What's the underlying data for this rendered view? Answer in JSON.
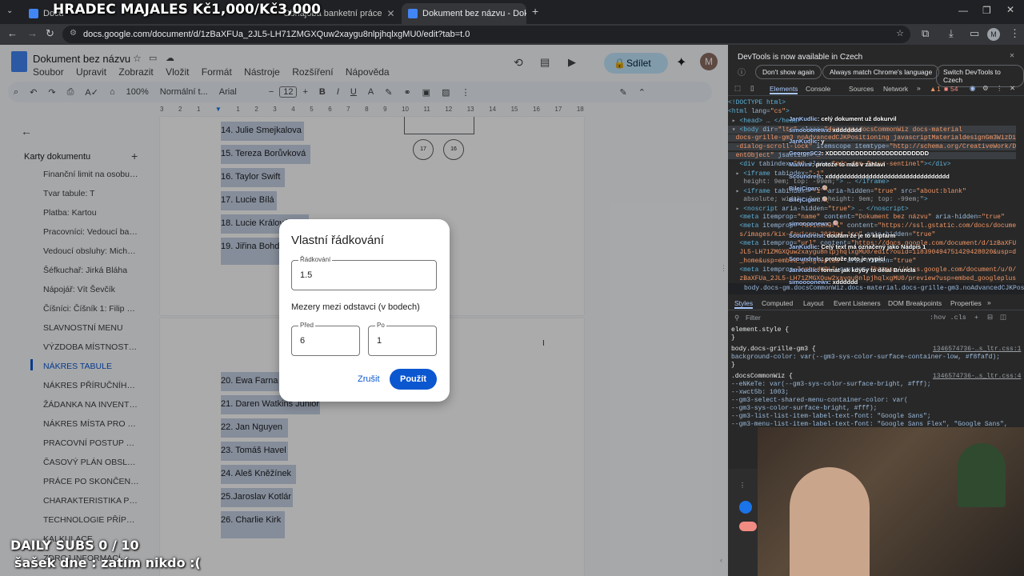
{
  "browser": {
    "tabs": [
      {
        "label": "Docu"
      },
      {
        "label": "Obhajoba banketní práce"
      },
      {
        "label": "Dokument bez názvu - Dokum"
      }
    ],
    "url": "docs.google.com/document/d/1zBaXFUa_2JL5-LH71ZMGXQuw2xaygu8nlpjhqlxgMU0/edit?tab=t.0"
  },
  "stream": {
    "banner": "HRADEC MAJALES Kč1,000/Kč3,000",
    "subs": "DAILY SUBS 0 / 10",
    "sasek": "šašek dne : zatím nikdo :("
  },
  "docs": {
    "title": "Dokument bez názvu",
    "menu": [
      "Soubor",
      "Upravit",
      "Zobrazit",
      "Vložit",
      "Formát",
      "Nástroje",
      "Rozšíření",
      "Nápověda"
    ],
    "share": "Sdílet",
    "avatar": "M",
    "toolbar": {
      "zoom": "100%",
      "style": "Normální t...",
      "font": "Arial",
      "size": "12"
    },
    "ruler": [
      "3",
      "2",
      "1",
      "1",
      "2",
      "3",
      "4",
      "5",
      "6",
      "7",
      "8",
      "9",
      "10",
      "11",
      "12",
      "13",
      "14",
      "15",
      "16",
      "17",
      "18"
    ],
    "sidebar": {
      "heading": "Karty dokumentu",
      "items": [
        "Finanční limit na osobu: 1...",
        "Tvar tabule: T",
        "Platba: Kartou",
        "Pracovníci: Vedoucí bank...",
        "Vedoucí obsluhy: Michal ...",
        "Šéfkuchař: Jirká Bláha",
        "Nápojář: Vít Ševčík",
        "Číšníci: Číšník 1: Filip Kon...",
        "SLAVNOSTNÍ MENU",
        "VÝZDOBA MÍSTNOSTI A T...",
        "NÁKRES TABULE",
        "NÁKRES PŘÍRUČNÍHO ST...",
        "ŽÁDANKA NA INVENTÁŘ",
        "NÁKRES MÍSTA PRO JED...",
        "PRACOVNÍ POSTUP PŘÍP...",
        "ČASOVÝ PLÁN OBSLUHY",
        "PRÁCE PO SKONČENÍ H...",
        "CHARAKTERISTIKA POKR...",
        "TECHNOLOGIE PŘÍPRAV...",
        "KALKULACE",
        "ZDROJ INFORMACÍ, ODK..."
      ],
      "active_index": 10
    },
    "names_page1": [
      "14. Julie Smejkalova",
      "15. Tereza Borůvková",
      "16. Taylor Swift",
      "17. Lucie Bílá",
      "18. Lucie Králová",
      "19. Jiřina Bohdalová"
    ],
    "names_page2": [
      "20. Ewa Farna",
      "21. Daren Watkins Junior",
      "22. Jan Nguyen",
      "23. Tomáš Havel",
      "24. Aleš Kněžínek",
      "25.Jaroslav Kotlár",
      "26. Charlie Kirk"
    ],
    "seats": [
      "17",
      "16"
    ]
  },
  "dialog": {
    "title": "Vlastní řádkování",
    "line_label": "Řádkování",
    "line_value": "1.5",
    "spacing_heading": "Mezery mezi odstavci (v bodech)",
    "before_label": "Před",
    "before_value": "6",
    "after_label": "Po",
    "after_value": "1",
    "cancel": "Zrušit",
    "apply": "Použít"
  },
  "devtools": {
    "notice": "DevTools is now available in Czech",
    "btn_always": "Don't show again",
    "btn_match": "Always match Chrome's language",
    "btn_switch": "Switch DevTools to Czech",
    "tabs": [
      "Elements",
      "Console",
      "Sources",
      "Network"
    ],
    "warn_count": "1",
    "err_count": "54",
    "breadcrumb": "body.docs-gm.docsCommonWiz.docs-material.docs-grille-gm3.noAdvancedCJKPositioning.jav",
    "style_tabs": [
      "Styles",
      "Computed",
      "Layout",
      "Event Listeners",
      "DOM Breakpoints",
      "Properties"
    ],
    "filter": "Filter",
    "hov": ":hov .cls",
    "css_lines": [
      "element.style {",
      "}",
      "body.docs-grille-gm3 {",
      "  background-color: var(--gm3-sys-color-surface-container-low, #f8fafd);",
      "}",
      ".docsCommonWiz {",
      "  --eNKeTe: var(--gm3-sys-color-surface-bright, #fff);",
      "  --xwct5b: 1003;",
      "  --gm3-select-shared-menu-container-color: var(",
      "    --gm3-sys-color-surface-bright, #fff);",
      "  --gm3-list-list-item-label-text-font: \"Google Sans\";",
      "  --gm3-menu-list-item-label-text-font: \"Google Sans Flex\", \"Google Sans\","
    ],
    "css_src1": "1346574736-…s_ltr.css:1",
    "css_src2": "1346574736-…s_ltr.css:4"
  },
  "chat": [
    {
      "user": "JanKudlic",
      "msg": ": celý dokument už dokurvil"
    },
    {
      "user": "simoooonewx",
      "msg": ": xddddddd"
    },
    {
      "user": "JanKudlic",
      "msg": ": y"
    },
    {
      "user": "GeorgeSC2",
      "msg": ": XDDDDDDDDDDDDDDDDDDDDDDD"
    },
    {
      "user": "MalWinr",
      "msg": ": protože to máš v záhlaví"
    },
    {
      "user": "Scoundrels",
      "msg": ": xddddddddddddddddddddddddddddddddd"
    },
    {
      "user": "BilejCigan",
      "msg": ": 🍭"
    },
    {
      "user": "BilejCigan",
      "msg": ": 🍭"
    },
    {
      "user": "simoooonewx",
      "msg": ": 🍭"
    },
    {
      "user": "ScoundrelsI",
      "msg": ": doufám že je to klipfarm"
    },
    {
      "user": "JanKudlic",
      "msg": ": Celý text má označený jako Nadpis 1"
    },
    {
      "user": "Scoundrels",
      "msg": ": protože toto je vypicí"
    },
    {
      "user": "JanKudlic",
      "msg": ": formát jak kdyby to dělal Bruncla"
    },
    {
      "user": "simoooonewx",
      "msg": ": xdddddd"
    }
  ]
}
